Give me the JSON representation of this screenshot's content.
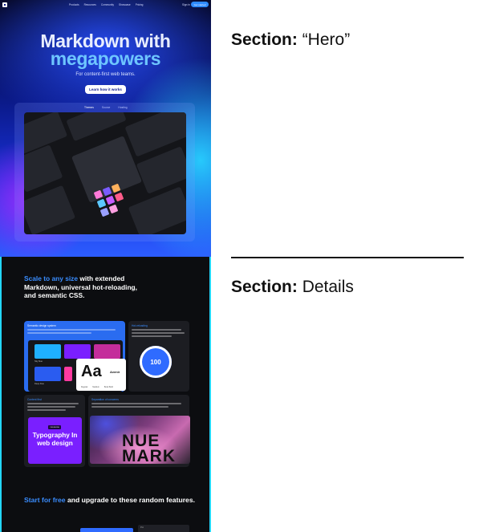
{
  "hero": {
    "nav": {
      "links": [
        "Products",
        "Resources",
        "Community",
        "Showcase",
        "Pricing"
      ],
      "sign_in": "Sign in",
      "get_started": "Get started"
    },
    "title_line1": "Markdown with",
    "title_line2": "megapowers",
    "subtitle": "For content-first web teams.",
    "cta": "Learn how it works",
    "tabs": [
      "Themes",
      "Source",
      "Hosting"
    ]
  },
  "details": {
    "headline_highlight": "Scale to any size",
    "headline_rest": "with extended Markdown, universal hot-reloading, and semantic CSS.",
    "card1_title": "Semantic design system",
    "card2_title": "Hot-reloading",
    "score": "100",
    "swatches": [
      "Sky blue",
      "Deep blue"
    ],
    "type_sample": "Aa",
    "font_name": "Avenir",
    "weights": [
      "Regular",
      "Medium",
      "Book Bold"
    ],
    "card3_title": "Content first",
    "typo_tag": "CSS MODE",
    "typo_text": "Typography In web design",
    "card4_title": "Separation of concerns",
    "nue_text_1": "NUE",
    "nue_text_2": "MARK",
    "footer_highlight": "Start for free",
    "footer_rest": "and upgrade to these random features.",
    "footer_right": "Pro"
  },
  "annotations": {
    "section_label": "Section:",
    "section1": "“Hero”",
    "section2": "Details"
  },
  "colors": {
    "accent_blue": "#3a8dff",
    "cyan_border": "#23d7ff",
    "purple": "#7a1fff"
  }
}
